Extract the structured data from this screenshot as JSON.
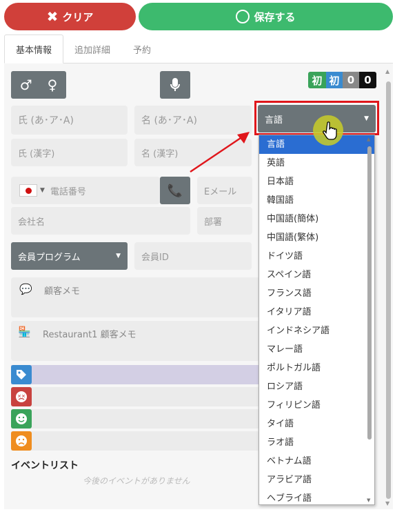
{
  "topbar": {
    "clear_label": "クリア",
    "save_label": "保存する"
  },
  "tabs": [
    {
      "label": "基本情報"
    },
    {
      "label": "追加詳細"
    },
    {
      "label": "予約"
    }
  ],
  "badges": [
    {
      "label": "初",
      "color": "#3aa35a"
    },
    {
      "label": "初",
      "color": "#3a8bd0"
    },
    {
      "label": "0",
      "color": "#888888"
    },
    {
      "label": "0",
      "color": "#111111"
    }
  ],
  "form": {
    "last_name_kana": "氏 (あ･ア･A)",
    "first_name_kana": "名 (あ･ア･A)",
    "last_name_kanji": "氏 (漢字)",
    "first_name_kanji": "名 (漢字)",
    "phone_placeholder": "電話番号",
    "email_placeholder": "Eメール",
    "company_placeholder": "会社名",
    "department_placeholder": "部署",
    "member_program": "会員プログラム",
    "member_id_placeholder": "会員ID",
    "customer_memo": "顧客メモ",
    "restaurant_memo": "Restaurant1 顧客メモ",
    "language_select": "言語"
  },
  "language_options": [
    "言語",
    "英語",
    "日本語",
    "韓国語",
    "中国語(簡体)",
    "中国語(繁体)",
    "ドイツ語",
    "スペイン語",
    "フランス語",
    "イタリア語",
    "インドネシア語",
    "マレー語",
    "ポルトガル語",
    "ロシア語",
    "フィリピン語",
    "タイ語",
    "ラオ語",
    "ベトナム語",
    "アラビア語",
    "ヘブライ語"
  ],
  "events": {
    "title": "イベントリスト",
    "empty": "今後のイベントがありません"
  },
  "colors": {
    "clear": "#d0403a",
    "save": "#3dba6e",
    "accent_select": "#2a6dd2",
    "highlight": "#e0161b"
  }
}
